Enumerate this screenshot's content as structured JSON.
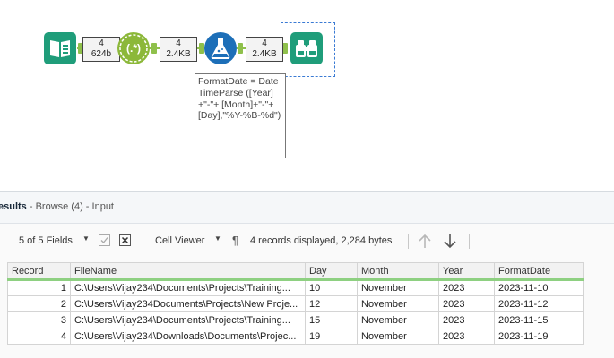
{
  "workflow": {
    "connections": [
      {
        "records": "4",
        "size": "624b"
      },
      {
        "records": "4",
        "size": "2.4KB"
      },
      {
        "records": "4",
        "size": "2.4KB"
      }
    ],
    "tools": [
      {
        "name": "Input Data",
        "icon": "input-book-icon",
        "color": "#1f9d7a"
      },
      {
        "name": "RegEx",
        "icon": "regex-icon",
        "color": "#8cb83a"
      },
      {
        "name": "Formula",
        "icon": "formula-flask-icon",
        "color": "#1d6fb8"
      },
      {
        "name": "Browse",
        "icon": "binoculars-icon",
        "color": "#1f9d7a"
      }
    ],
    "annotation": "FormatDate = DateTimeParse ([Year]+\"-\"+ [Month]+\"-\"+ [Day],\"%Y-%B-%d\")"
  },
  "results": {
    "title": "esults",
    "subtitle": " - Browse (4) - Input",
    "fields_label": "5 of 5 Fields",
    "viewer_label": "Cell Viewer",
    "summary": "4 records displayed, 2,284 bytes",
    "columns": [
      "Record",
      "FileName",
      "Day",
      "Month",
      "Year",
      "FormatDate"
    ],
    "rows": [
      [
        "1",
        "C:\\Users\\Vijay234\\Documents\\Projects\\Training...",
        "10",
        "November",
        "2023",
        "2023-11-10"
      ],
      [
        "2",
        "C:\\Users\\Vijay234Documents\\Projects\\New Proje...",
        "12",
        "November",
        "2023",
        "2023-11-12"
      ],
      [
        "3",
        "C:\\Users\\Vijay234\\Documents\\Projects\\Training...",
        "15",
        "November",
        "2023",
        "2023-11-15"
      ],
      [
        "4",
        "C:\\Users\\Vijay234\\Downloads\\Documents\\Projec...",
        "19",
        "November",
        "2023",
        "2023-11-19"
      ]
    ]
  }
}
